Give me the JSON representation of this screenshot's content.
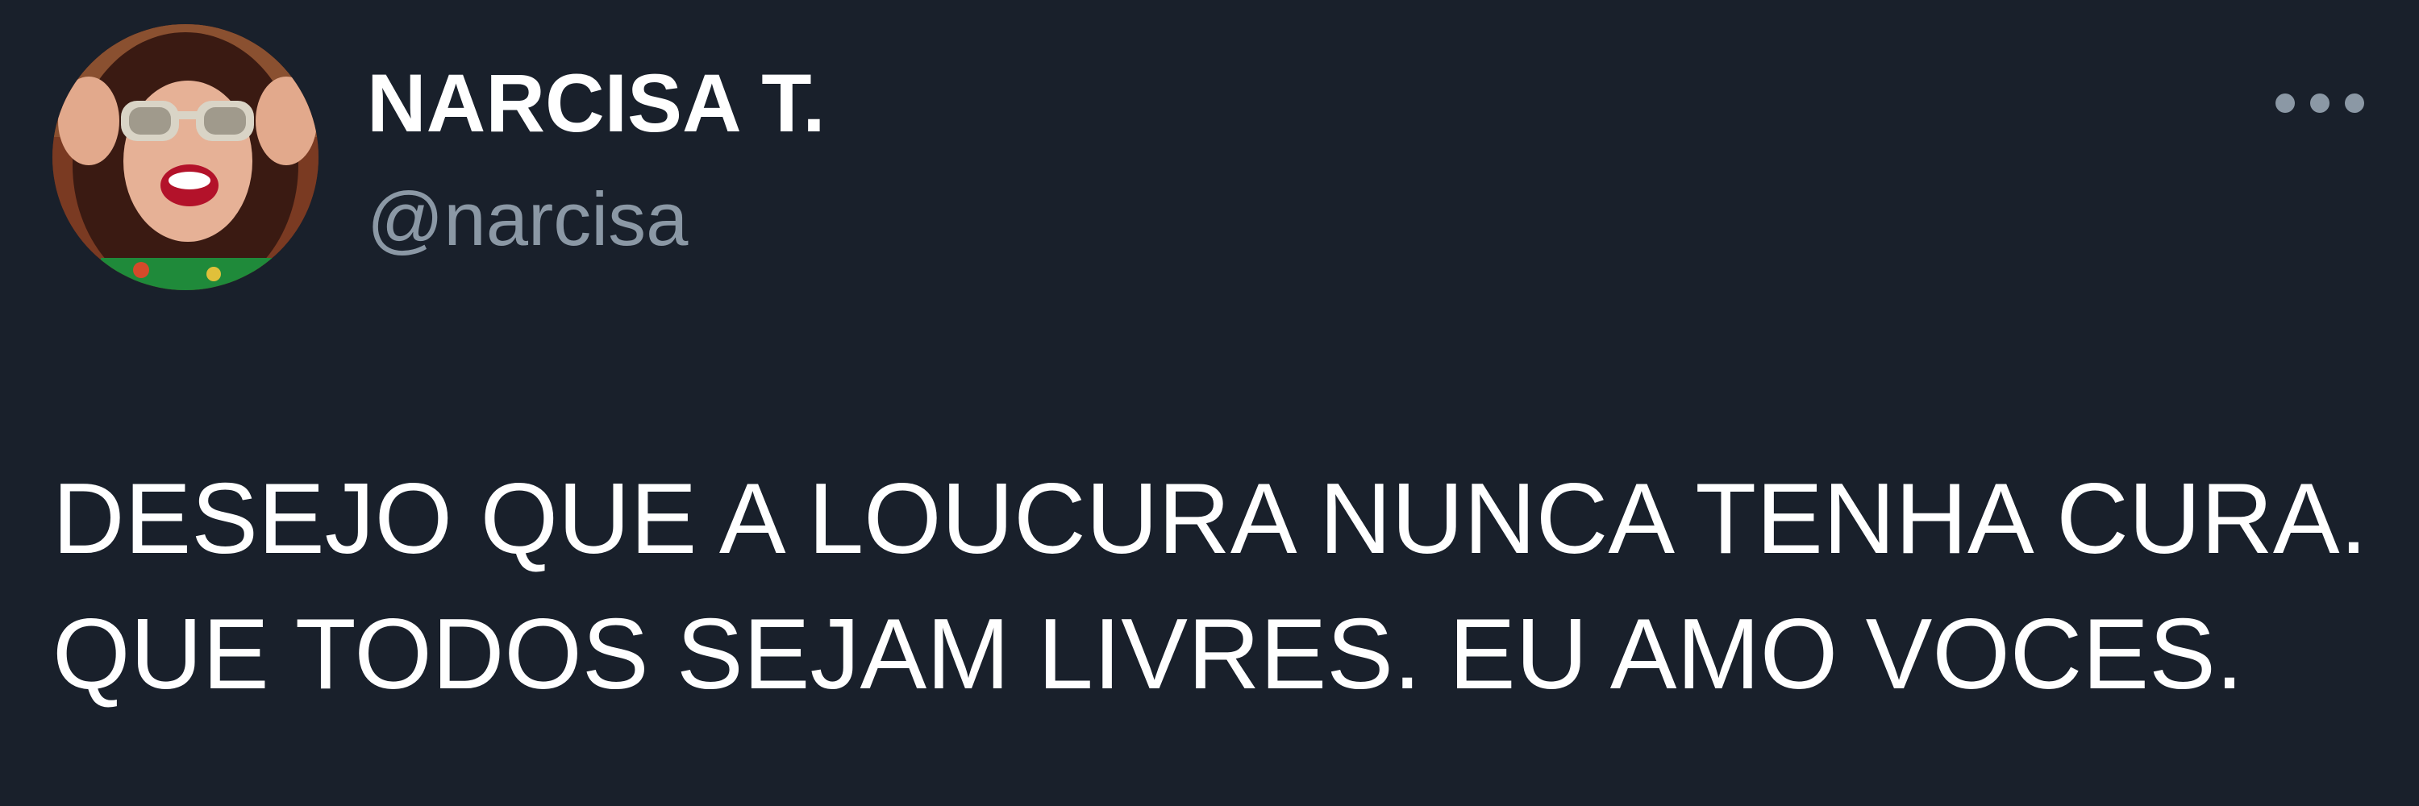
{
  "author": {
    "display_name": "NARCISA T.",
    "handle": "@narcisa",
    "avatar_description": "avatar"
  },
  "tweet": {
    "lines": [
      "DESEJO QUE A LOUCURA NUNCA TENHA CURA.",
      "QUE TODOS SEJAM LIVRES. EU AMO VOCES."
    ]
  },
  "icons": {
    "more": "more-options-icon"
  },
  "colors": {
    "background": "#19202b",
    "text_primary": "#ffffff",
    "text_secondary": "#8b98a5"
  }
}
